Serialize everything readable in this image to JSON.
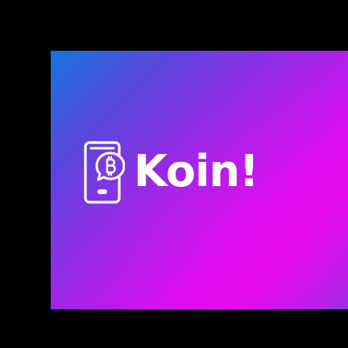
{
  "brand": {
    "name": "Koin!",
    "icon": "phone-bitcoin-chat-icon",
    "colors": {
      "text": "#ffffff",
      "gradient_start": "#1673e0",
      "gradient_mid": "#d80ef0",
      "gradient_end": "#7a3cde",
      "background": "#000000"
    }
  }
}
